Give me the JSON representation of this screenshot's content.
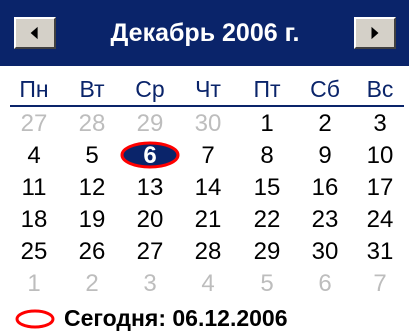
{
  "calendar": {
    "title": "Декабрь 2006 г.",
    "prev_icon": "triangle-left-icon",
    "next_icon": "triangle-right-icon",
    "weekdays": [
      "Пн",
      "Вт",
      "Ср",
      "Чт",
      "Пт",
      "Сб",
      "Вс"
    ],
    "weeks": [
      [
        {
          "d": "27",
          "other": true
        },
        {
          "d": "28",
          "other": true
        },
        {
          "d": "29",
          "other": true
        },
        {
          "d": "30",
          "other": true
        },
        {
          "d": "1"
        },
        {
          "d": "2"
        },
        {
          "d": "3"
        }
      ],
      [
        {
          "d": "4"
        },
        {
          "d": "5"
        },
        {
          "d": "6",
          "selected": true
        },
        {
          "d": "7"
        },
        {
          "d": "8"
        },
        {
          "d": "9"
        },
        {
          "d": "10"
        }
      ],
      [
        {
          "d": "11"
        },
        {
          "d": "12"
        },
        {
          "d": "13"
        },
        {
          "d": "14"
        },
        {
          "d": "15"
        },
        {
          "d": "16"
        },
        {
          "d": "17"
        }
      ],
      [
        {
          "d": "18"
        },
        {
          "d": "19"
        },
        {
          "d": "20"
        },
        {
          "d": "21"
        },
        {
          "d": "22"
        },
        {
          "d": "23"
        },
        {
          "d": "24"
        }
      ],
      [
        {
          "d": "25"
        },
        {
          "d": "26"
        },
        {
          "d": "27"
        },
        {
          "d": "28"
        },
        {
          "d": "29"
        },
        {
          "d": "30"
        },
        {
          "d": "31"
        }
      ],
      [
        {
          "d": "1",
          "other": true
        },
        {
          "d": "2",
          "other": true
        },
        {
          "d": "3",
          "other": true
        },
        {
          "d": "4",
          "other": true
        },
        {
          "d": "5",
          "other": true
        },
        {
          "d": "6",
          "other": true
        },
        {
          "d": "7",
          "other": true
        }
      ]
    ],
    "today_label": "Сегодня: 06.12.2006",
    "colors": {
      "header_bg": "#0a246a",
      "selected_fill": "#0a246a",
      "today_ring": "#ff0000",
      "other_month": "#bdbdbd"
    }
  }
}
